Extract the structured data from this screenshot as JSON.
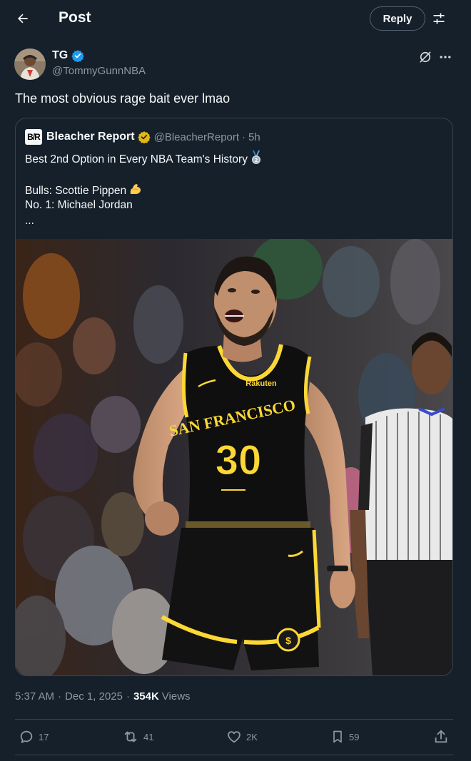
{
  "header": {
    "title": "Post",
    "reply_label": "Reply"
  },
  "author": {
    "name": "TG",
    "handle": "@TommyGunnNBA"
  },
  "post": {
    "text": "The most obvious rage bait ever lmao"
  },
  "quote": {
    "logo_text": "B/R",
    "name": "Bleacher Report",
    "handle": "@BleacherReport",
    "dot": "·",
    "time": "5h",
    "line1": "Best 2nd Option in Every NBA Team's History",
    "line2": "",
    "line3": "Bulls: Scottie Pippen",
    "line4": "No. 1: Michael Jordan",
    "line5": "...",
    "image_jersey_text": "SAN FRANCISCO",
    "image_jersey_number": "30",
    "image_sponsor": "Rakuten"
  },
  "meta": {
    "time": "5:37 AM",
    "sep": "·",
    "date": "Dec 1, 2025",
    "views_count": "354K",
    "views_label": "Views"
  },
  "actions": {
    "replies": "17",
    "reposts": "41",
    "likes": "2K",
    "bookmarks": "59"
  },
  "colors": {
    "background": "#15202b",
    "border": "#38444d",
    "secondary_text": "#8b98a5",
    "verified": "#1d9bf0",
    "gold_badge": "#e2b719",
    "jersey": "#0f0f0f",
    "jersey_trim": "#fdd835"
  },
  "icons": [
    "back-arrow-icon",
    "filter-sliders-icon",
    "verified-badge-icon",
    "grok-icon",
    "more-icon",
    "gold-verified-badge-icon",
    "silver-medal-emoji",
    "flexed-biceps-emoji",
    "reply-icon",
    "repost-icon",
    "like-icon",
    "bookmark-icon",
    "share-icon"
  ]
}
